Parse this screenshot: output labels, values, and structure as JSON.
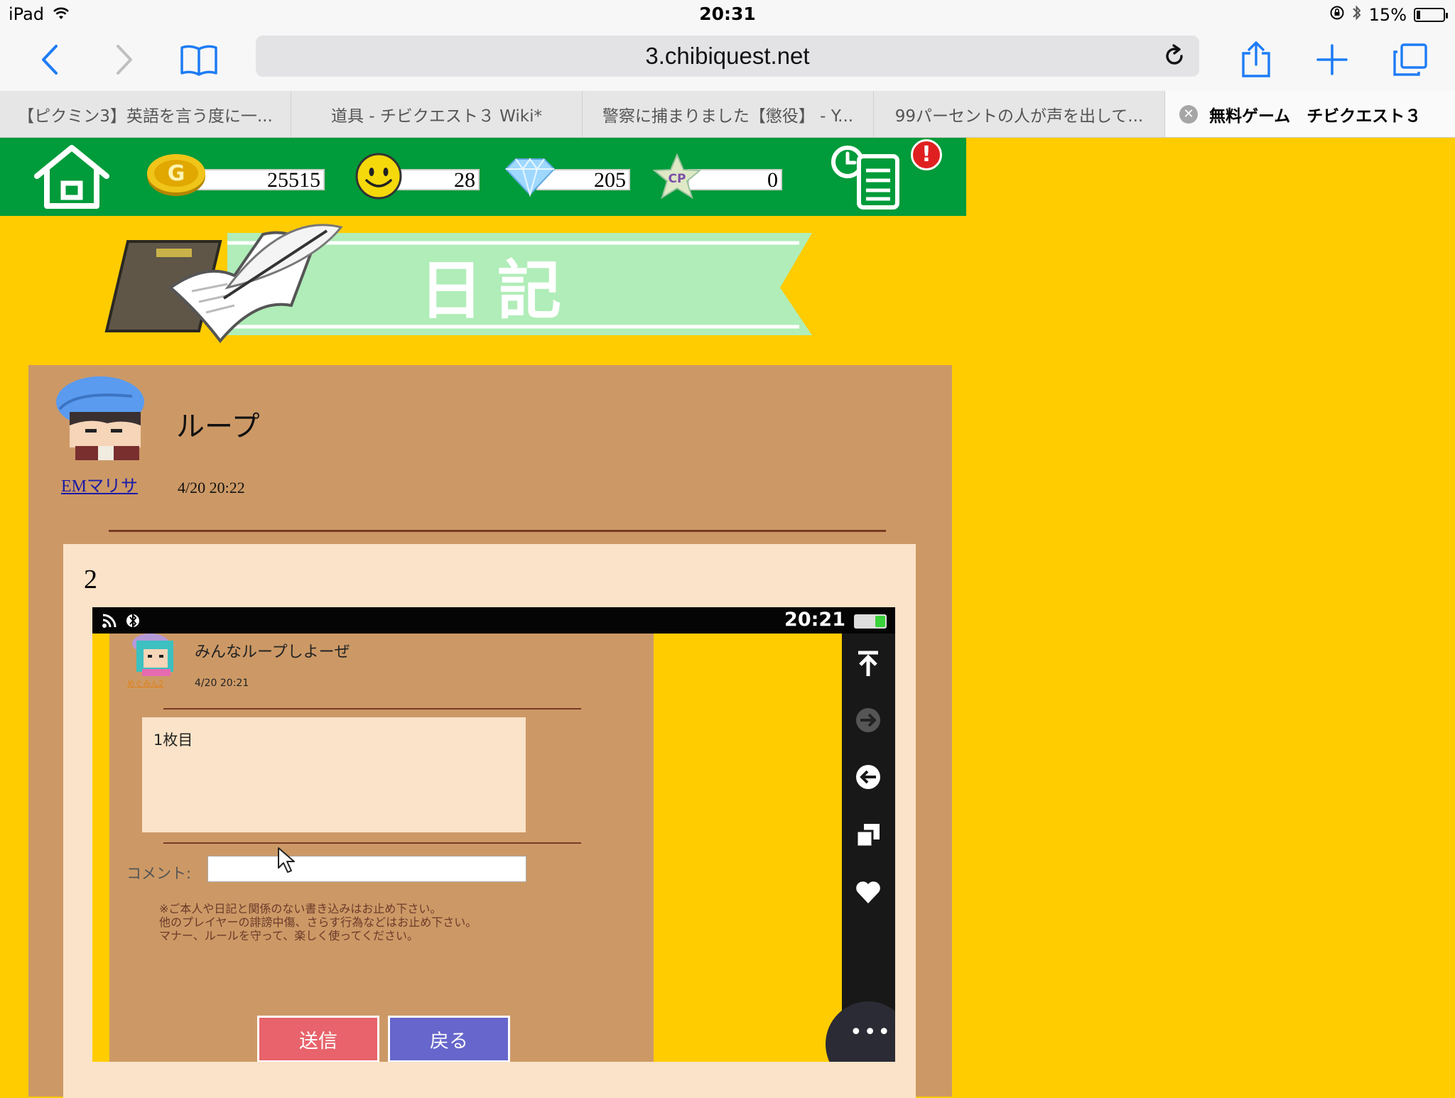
{
  "status": {
    "device": "iPad",
    "time": "20:31",
    "battery": "15%",
    "battery_level": 0.15
  },
  "browser": {
    "url": "3.chibiquest.net",
    "tabs": [
      "【ピクミン3】英語を言う度に一...",
      "道具 - チビクエスト３ Wiki*",
      "警察に捕まりました【懲役】 - Y...",
      "99パーセントの人が声を出して...",
      "無料ゲーム　チビクエスト３"
    ]
  },
  "game": {
    "gold": "25515",
    "smile": "28",
    "diamond": "205",
    "cp_label": "CP",
    "cp": "0",
    "gold_label": "G",
    "alert": "!"
  },
  "diary": {
    "banner_title": "日記",
    "author": "EMマリサ",
    "title": "ループ",
    "date": "4/20 20:22",
    "body_number": "2"
  },
  "screenshot": {
    "time": "20:21",
    "post_title": "みんなループしよーぜ",
    "post_author": "めぐみん2",
    "post_date": "4/20 20:21",
    "post_body": "1枚目",
    "comment_label": "コメント:",
    "notes": [
      "※ご本人や日記と関係のない書き込みはお止め下さい。",
      "他のプレイヤーの誹謗中傷、さらす行為などはお止め下さい。",
      "マナー、ルールを守って、楽しく使ってください。"
    ],
    "send_label": "送信",
    "back_label": "戻る",
    "more_label": "•••"
  },
  "colors": {
    "background": "#ffcc00",
    "header": "#009b3a",
    "panel": "#cc9966",
    "content": "#fae3c8",
    "send": "#e8636b",
    "back": "#6666cc",
    "link": "#1a1aa6"
  }
}
